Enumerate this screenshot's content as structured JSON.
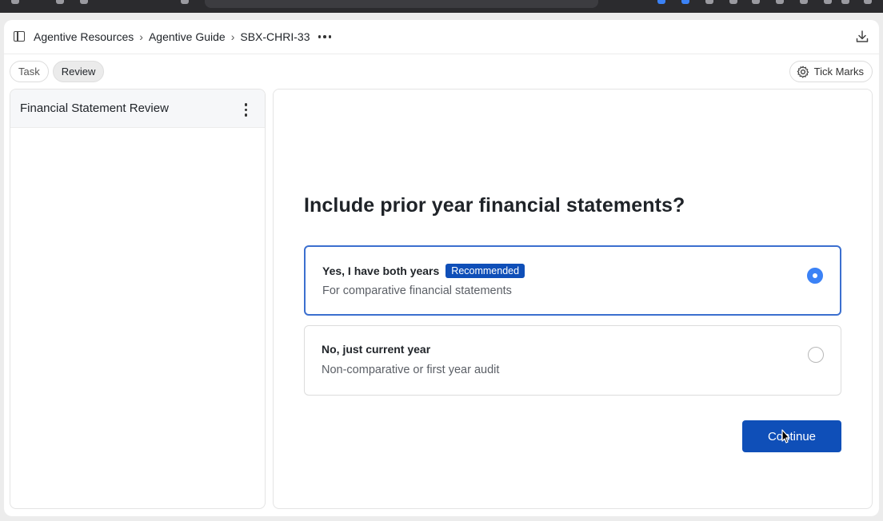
{
  "breadcrumb": {
    "items": [
      "Agentive Resources",
      "Agentive Guide",
      "SBX-CHRI-33"
    ],
    "separator": "›"
  },
  "tabs": [
    {
      "label": "Task",
      "active": false
    },
    {
      "label": "Review",
      "active": true
    }
  ],
  "toolbar": {
    "tick_marks_label": "Tick Marks"
  },
  "left_panel": {
    "title": "Financial Statement Review"
  },
  "main": {
    "question": "Include prior year financial statements?",
    "options": [
      {
        "label": "Yes, I have both years",
        "badge": "Recommended",
        "description": "For comparative financial statements",
        "selected": true
      },
      {
        "label": "No, just current year",
        "badge": "",
        "description": "Non-comparative or first year audit",
        "selected": false
      }
    ],
    "continue_label": "Continue"
  },
  "colors": {
    "accent": "#0f4fb8",
    "radio_selected": "#3b82f6",
    "selected_border": "#3b6fcf"
  }
}
